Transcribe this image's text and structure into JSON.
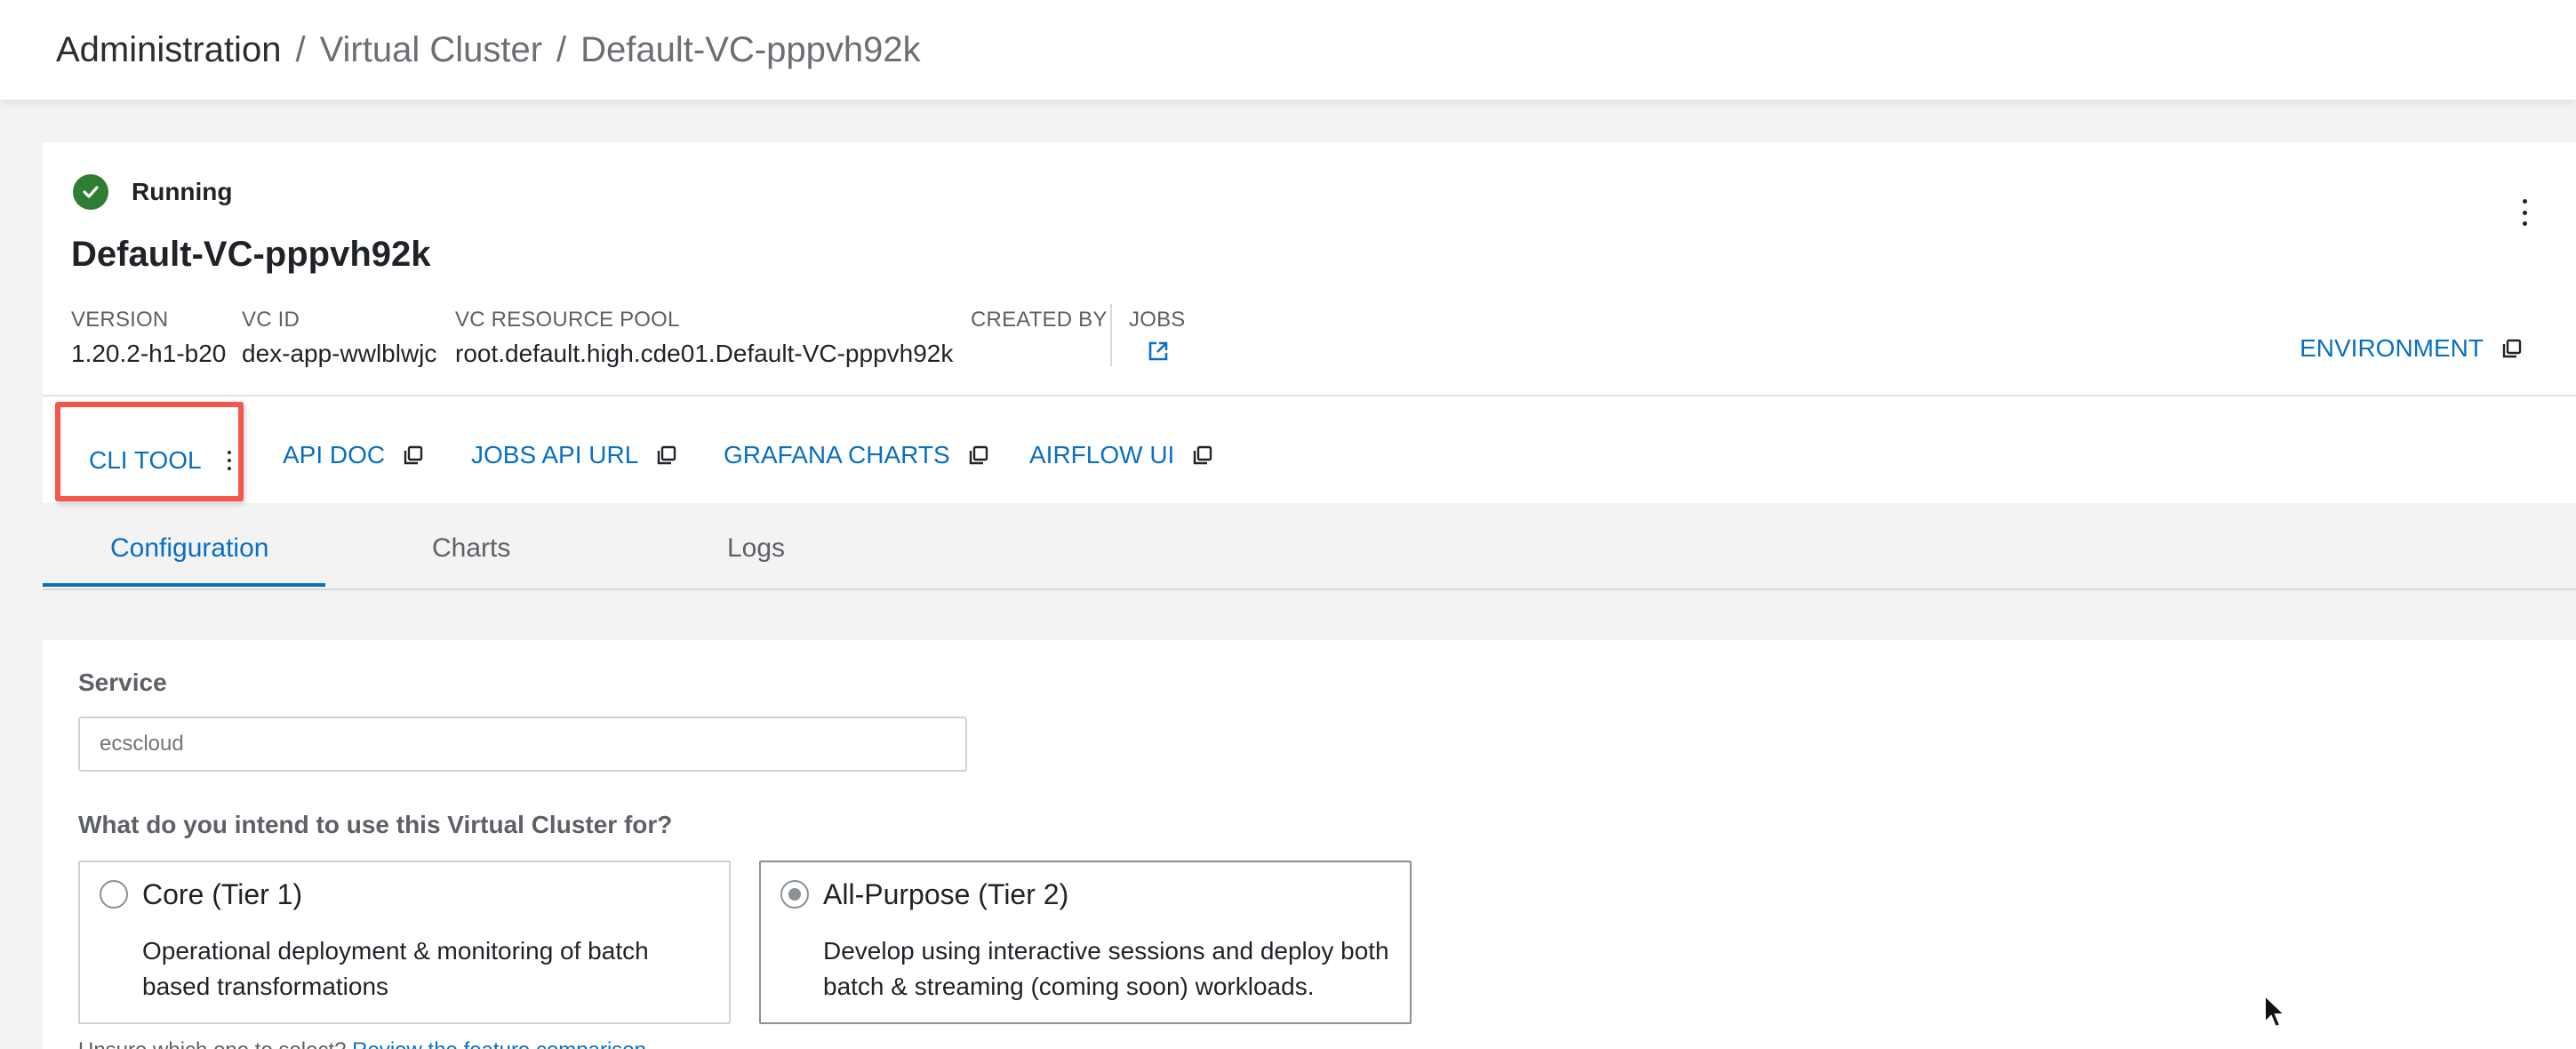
{
  "breadcrumb": {
    "items": [
      "Administration",
      "Virtual Cluster",
      "Default-VC-pppvh92k"
    ],
    "separator": "/"
  },
  "status": {
    "label": "Running",
    "color": "#2e7d32"
  },
  "vc": {
    "name": "Default-VC-pppvh92k",
    "meta": [
      {
        "label": "VERSION",
        "value": "1.20.2-h1-b20"
      },
      {
        "label": "VC ID",
        "value": "dex-app-wwlblwjc"
      },
      {
        "label": "VC RESOURCE POOL",
        "value": "root.default.high.cde01.Default-VC-pppvh92k"
      },
      {
        "label": "CREATED BY",
        "value": ""
      },
      {
        "label": "JOBS",
        "value": ""
      }
    ],
    "environment_label": "ENVIRONMENT"
  },
  "links": {
    "cli_tool": "CLI TOOL",
    "api_doc": "API DOC",
    "jobs_api_url": "JOBS API URL",
    "grafana_charts": "GRAFANA CHARTS",
    "airflow_ui": "AIRFLOW UI"
  },
  "tabs": [
    {
      "label": "Configuration",
      "active": true
    },
    {
      "label": "Charts",
      "active": false
    },
    {
      "label": "Logs",
      "active": false
    }
  ],
  "config": {
    "service_label": "Service",
    "service_placeholder": "ecscloud",
    "question": "What do you intend to use this Virtual Cluster for?",
    "tiers": [
      {
        "title": "Core (Tier 1)",
        "description": "Operational deployment & monitoring of batch based transformations",
        "selected": false
      },
      {
        "title": "All-Purpose (Tier 2)",
        "description": "Develop using interactive sessions and deploy both batch & streaming (coming soon) workloads.",
        "selected": true
      }
    ],
    "footer_text": "Unsure which one to select?",
    "footer_link": "Review the feature comparison"
  },
  "colors": {
    "accent": "#0a6fc2",
    "highlight_box": "#f2564d",
    "running": "#2e7d32"
  }
}
